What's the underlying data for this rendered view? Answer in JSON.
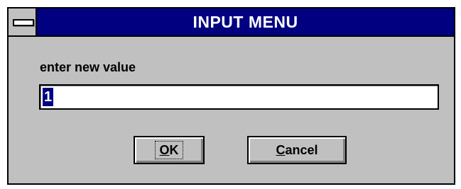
{
  "dialog": {
    "title": "INPUT MENU",
    "system_menu_icon": "system-menu-icon",
    "prompt": "enter new value",
    "input_value": "1",
    "buttons": {
      "ok": {
        "mnemonic": "O",
        "rest": "K"
      },
      "cancel": {
        "mnemonic": "C",
        "rest": "ancel"
      }
    }
  },
  "colors": {
    "titlebar": "#000080",
    "face": "#c0c0c0",
    "selection": "#000080"
  }
}
